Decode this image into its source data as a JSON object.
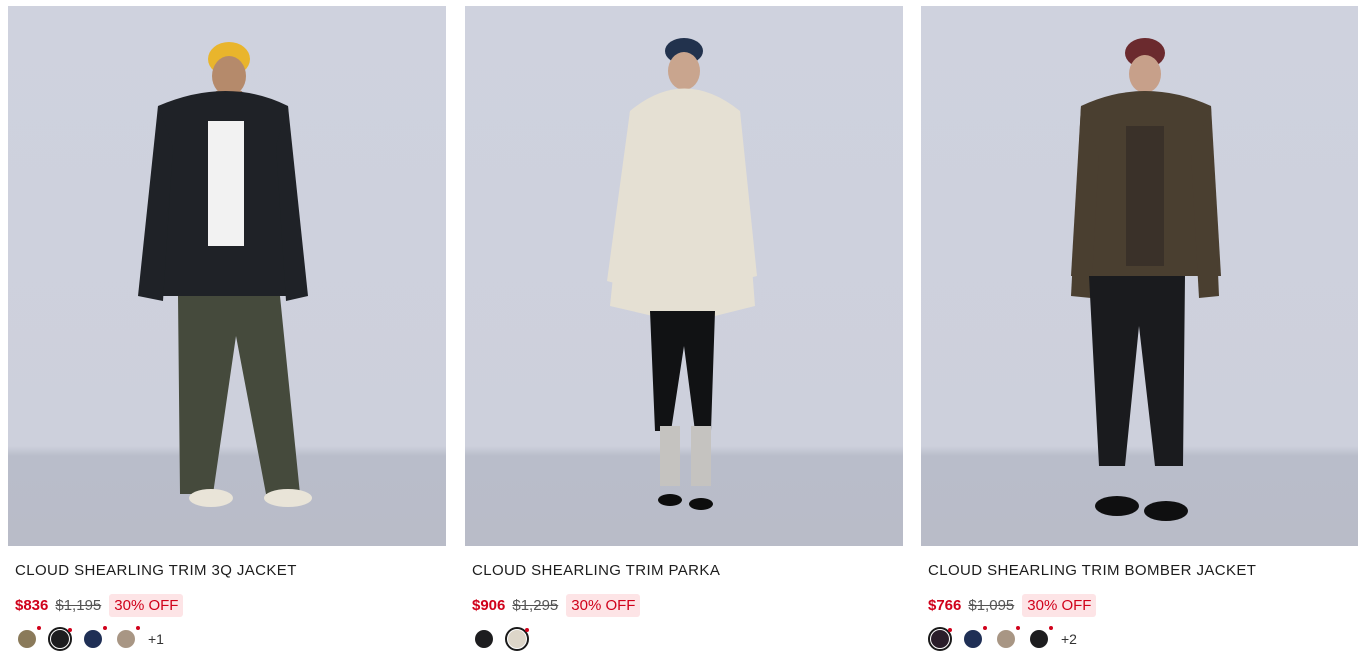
{
  "products": [
    {
      "name": "CLOUD SHEARLING TRIM 3Q JACKET",
      "sale_price": "$836",
      "original_price": "$1,195",
      "discount": "30% OFF",
      "more_colors": "+1",
      "image": {
        "coat_color": "#1f2227",
        "cap_color": "#e9b52c",
        "pants_color": "#454a3c",
        "shoe_color": "#e9e4d8"
      },
      "swatches": [
        {
          "color": "#8a7a5a",
          "selected": false
        },
        {
          "color": "#1d1d1f",
          "selected": true
        },
        {
          "color": "#1f2f55",
          "selected": false
        },
        {
          "color": "#a89684",
          "selected": false
        }
      ]
    },
    {
      "name": "CLOUD SHEARLING TRIM PARKA",
      "sale_price": "$906",
      "original_price": "$1,295",
      "discount": "30% OFF",
      "more_colors": "",
      "image": {
        "coat_color": "#e5e0d3",
        "cap_color": "#22324d",
        "pants_color": "#111214",
        "shoe_color": "#0d0d0d"
      },
      "swatches": [
        {
          "color": "#1d1d1f",
          "selected": false
        },
        {
          "color": "#ddd6c9",
          "selected": true
        }
      ]
    },
    {
      "name": "CLOUD SHEARLING TRIM BOMBER JACKET",
      "sale_price": "$766",
      "original_price": "$1,095",
      "discount": "30% OFF",
      "more_colors": "+2",
      "image": {
        "coat_color": "#4a3f30",
        "cap_color": "#6b2a2e",
        "pants_color": "#1a1b1e",
        "shoe_color": "#0f0f10"
      },
      "swatches": [
        {
          "color": "#2a1e2a",
          "selected": true
        },
        {
          "color": "#1f2f55",
          "selected": false
        },
        {
          "color": "#a89684",
          "selected": false
        },
        {
          "color": "#1d1d1f",
          "selected": false
        }
      ]
    }
  ]
}
